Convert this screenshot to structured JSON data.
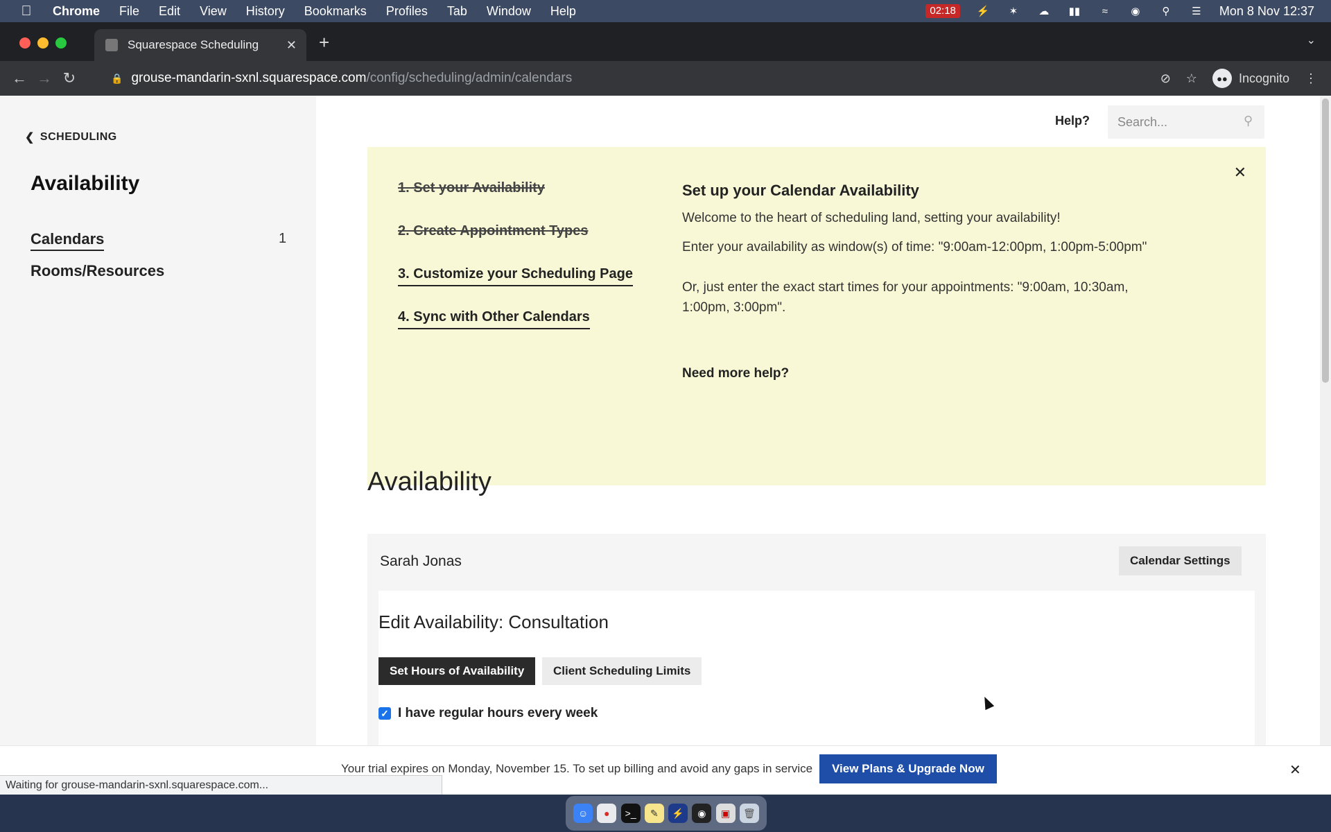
{
  "menubar": {
    "app": "Chrome",
    "items": [
      "File",
      "Edit",
      "View",
      "History",
      "Bookmarks",
      "Profiles",
      "Tab",
      "Window",
      "Help"
    ],
    "recording_time": "02:18",
    "clock": "Mon 8 Nov  12:37"
  },
  "browser": {
    "tab_title": "Squarespace Scheduling",
    "url_host": "grouse-mandarin-sxnl.squarespace.com",
    "url_path": "/config/scheduling/admin/calendars",
    "profile_label": "Incognito",
    "status_text": "Waiting for grouse-mandarin-sxnl.squarespace.com..."
  },
  "sidebar": {
    "back_label": "SCHEDULING",
    "title": "Availability",
    "items": [
      {
        "label": "Calendars",
        "count": "1"
      },
      {
        "label": "Rooms/Resources"
      }
    ]
  },
  "header": {
    "help_label": "Help?",
    "search_placeholder": "Search..."
  },
  "banner": {
    "steps": [
      "1. Set your Availability",
      "2. Create Appointment Types",
      "3. Customize your Scheduling Page",
      "4. Sync with Other Calendars"
    ],
    "title": "Set up your Calendar Availability",
    "p1": "Welcome to the heart of scheduling land, setting your availability!",
    "p2": "Enter your availability as window(s) of time: \"9:00am-12:00pm, 1:00pm-5:00pm\"",
    "p3": "Or, just enter the exact start times for your appointments: \"9:00am, 10:30am, 1:00pm, 3:00pm\".",
    "help_link": "Need more help?"
  },
  "main": {
    "title": "Availability",
    "calendar_name": "Sarah Jonas",
    "calendar_settings_label": "Calendar Settings",
    "edit_title": "Edit Availability: Consultation",
    "tabs": [
      "Set Hours of Availability",
      "Client Scheduling Limits"
    ],
    "regular_hours_label": "I have regular hours every week",
    "regular_hours_checked": true
  },
  "trial": {
    "text": "Your trial expires on Monday, November 15.  To set up billing and avoid any gaps in service",
    "button_label": "View Plans & Upgrade Now"
  },
  "colors": {
    "banner_bg": "#f8f8d6",
    "upgrade_button": "#1f4ea8",
    "active_tab": "#2b2b2b"
  }
}
